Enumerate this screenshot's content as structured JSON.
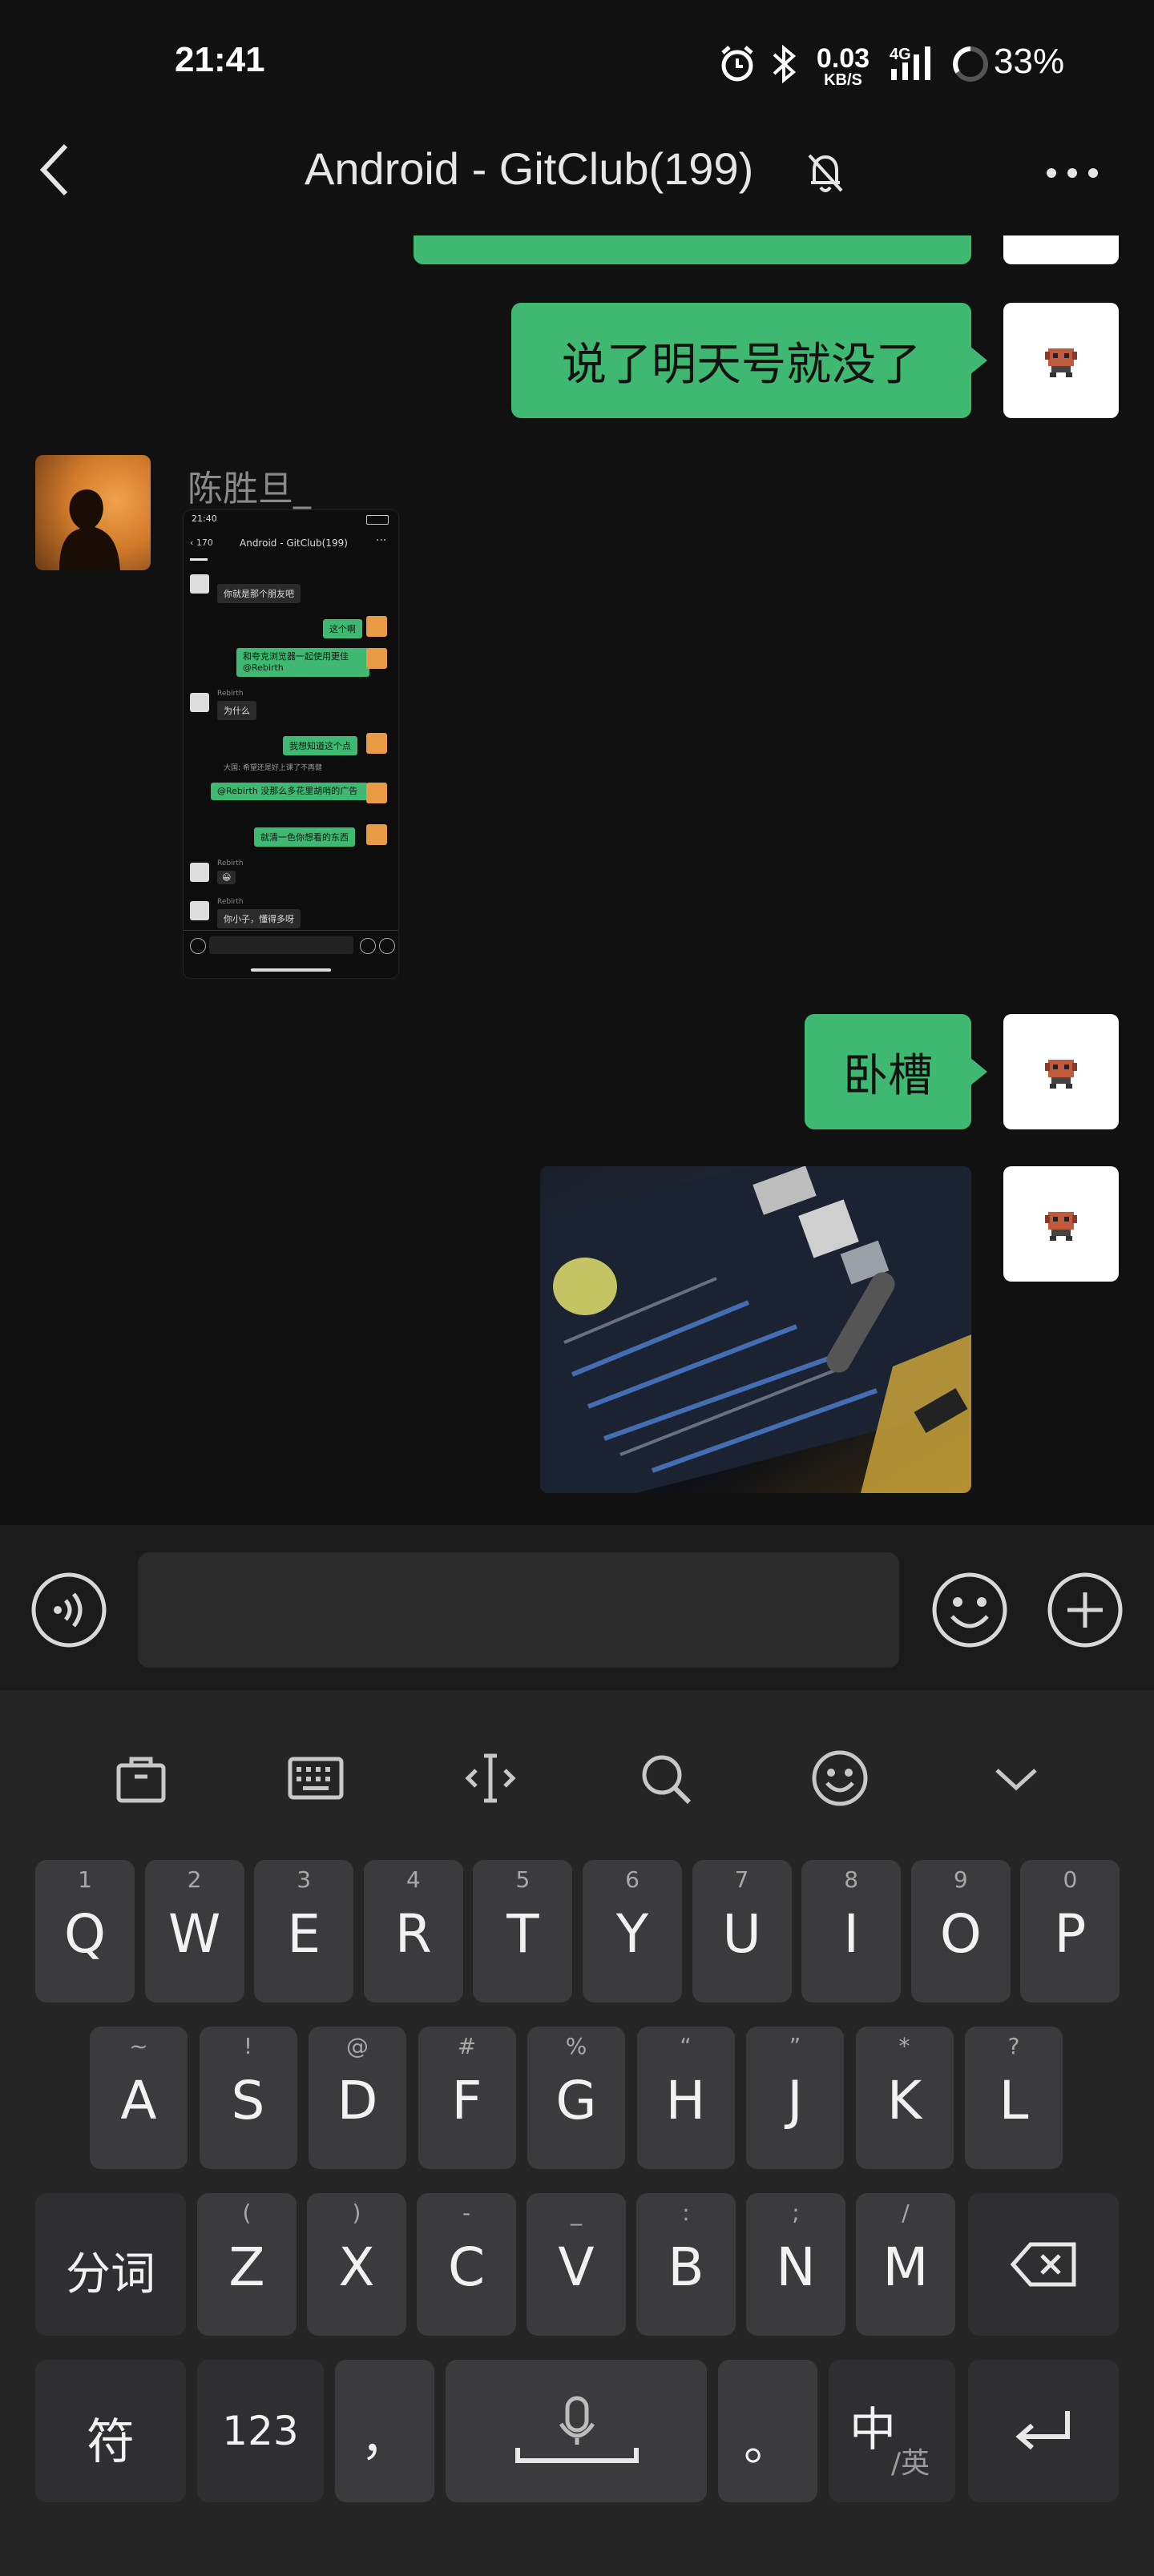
{
  "status_bar": {
    "time": "21:41",
    "net_speed_value": "0.03",
    "net_speed_unit": "KB/S",
    "network": "4G",
    "battery": "33%"
  },
  "header": {
    "title": "Android - GitClub(199)"
  },
  "messages": [
    {
      "sender": "self",
      "type": "text",
      "text": "说了明天号就没了"
    },
    {
      "sender": "other",
      "name": "陈胜旦_",
      "type": "image",
      "image_desc": "screenshot of a chat"
    },
    {
      "sender": "self",
      "type": "text",
      "text": "卧槽"
    },
    {
      "sender": "self",
      "type": "image",
      "image_desc": "photo of a laptop screen"
    }
  ],
  "embedded_screenshot": {
    "time": "21:40",
    "title": "Android - GitClub(199)",
    "back_count": "170",
    "rows": [
      {
        "side": "left",
        "text": "你就是那个朋友吧"
      },
      {
        "side": "right",
        "text": "这个啊"
      },
      {
        "side": "right",
        "text": "和夸克浏览器一起使用更佳 @Rebirth"
      },
      {
        "side": "left",
        "name": "Rebirth",
        "text": "为什么"
      },
      {
        "side": "right",
        "text": "我想知道这个点"
      },
      {
        "side": "center",
        "text": "大国: 希望还是好上课了不再健"
      },
      {
        "side": "right",
        "text": "@Rebirth 没那么多花里胡哨的广告"
      },
      {
        "side": "right",
        "text": "就清一色你想看的东西"
      },
      {
        "side": "left",
        "name": "Rebirth",
        "text": "😀"
      },
      {
        "side": "left",
        "name": "Rebirth",
        "text": "你小子，懂得多呀"
      }
    ]
  },
  "keyboard": {
    "rows": [
      [
        [
          "Q",
          "1"
        ],
        [
          "W",
          "2"
        ],
        [
          "E",
          "3"
        ],
        [
          "R",
          "4"
        ],
        [
          "T",
          "5"
        ],
        [
          "Y",
          "6"
        ],
        [
          "U",
          "7"
        ],
        [
          "I",
          "8"
        ],
        [
          "O",
          "9"
        ],
        [
          "P",
          "0"
        ]
      ],
      [
        [
          "A",
          "~"
        ],
        [
          "S",
          "!"
        ],
        [
          "D",
          "@"
        ],
        [
          "F",
          "#"
        ],
        [
          "G",
          "%"
        ],
        [
          "H",
          "“"
        ],
        [
          "J",
          "”"
        ],
        [
          "K",
          "*"
        ],
        [
          "L",
          "?"
        ]
      ],
      [
        [
          "Z",
          "("
        ],
        [
          "X",
          ")"
        ],
        [
          "C",
          "-"
        ],
        [
          "V",
          "_"
        ],
        [
          "B",
          ":"
        ],
        [
          "N",
          ";"
        ],
        [
          "M",
          "/"
        ]
      ]
    ],
    "shift_label": "分词",
    "symbols_label": "符",
    "numbers_label": "123",
    "comma": "，",
    "period": "。",
    "lang_main": "中",
    "lang_sub": "/英"
  },
  "colors": {
    "background": "#111111",
    "bubble_green": "#3fb872",
    "keyboard_bg": "#252526",
    "key_bg": "#3b3b3d"
  }
}
